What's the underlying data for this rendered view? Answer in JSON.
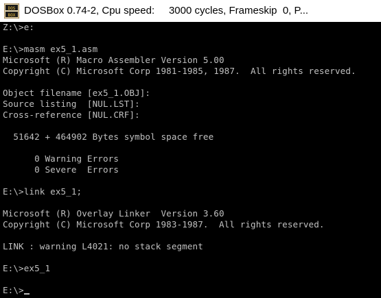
{
  "window": {
    "title": "DOSBox 0.74-2, Cpu speed:     3000 cycles, Frameskip  0, P..."
  },
  "icons": {
    "app": "dosbox-icon",
    "cursor": "text-cursor-icon"
  },
  "console": {
    "lines": [
      "Z:\\>e:",
      "",
      "E:\\>masm ex5_1.asm",
      "Microsoft (R) Macro Assembler Version 5.00",
      "Copyright (C) Microsoft Corp 1981-1985, 1987.  All rights reserved.",
      "",
      "Object filename [ex5_1.OBJ]:",
      "Source listing  [NUL.LST]:",
      "Cross-reference [NUL.CRF]:",
      "",
      "  51642 + 464902 Bytes symbol space free",
      "",
      "      0 Warning Errors",
      "      0 Severe  Errors",
      "",
      "E:\\>link ex5_1;",
      "",
      "Microsoft (R) Overlay Linker  Version 3.60",
      "Copyright (C) Microsoft Corp 1983-1987.  All rights reserved.",
      "",
      "LINK : warning L4021: no stack segment",
      "",
      "E:\\>ex5_1",
      "",
      "E:\\>"
    ]
  },
  "colors": {
    "console_bg": "#000000",
    "console_fg": "#c0c0c0",
    "titlebar_bg": "#ffffff"
  }
}
